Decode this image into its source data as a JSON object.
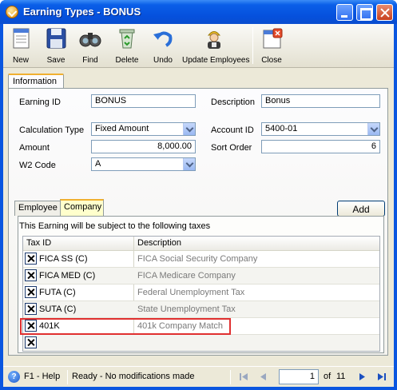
{
  "window": {
    "title": "Earning Types - BONUS"
  },
  "toolbar": {
    "new": "New",
    "save": "Save",
    "find": "Find",
    "delete": "Delete",
    "undo": "Undo",
    "update_employees": "Update Employees",
    "close": "Close"
  },
  "tabs": {
    "information": "Information"
  },
  "form": {
    "earning_id_label": "Earning ID",
    "earning_id": "BONUS",
    "description_label": "Description",
    "description": "Bonus",
    "calc_type_label": "Calculation Type",
    "calc_type": "Fixed Amount",
    "account_id_label": "Account ID",
    "account_id": "5400-01",
    "amount_label": "Amount",
    "amount": "8,000.00",
    "sort_order_label": "Sort Order",
    "sort_order": "6",
    "w2_code_label": "W2 Code",
    "w2_code": "A"
  },
  "subtabs": {
    "employee": "Employee",
    "company": "Company"
  },
  "add_button": "Add",
  "taxes": {
    "caption": "This Earning will be subject to the following taxes",
    "columns": [
      "Tax ID",
      "Description"
    ],
    "rows": [
      {
        "id": "FICA SS (C)",
        "desc": "FICA Social Security Company"
      },
      {
        "id": "FICA MED (C)",
        "desc": "FICA Medicare Company"
      },
      {
        "id": "FUTA (C)",
        "desc": "Federal Unemployment Tax"
      },
      {
        "id": "SUTA (C)",
        "desc": "State Unemployment Tax"
      },
      {
        "id": "401K",
        "desc": "401k Company Match"
      },
      {
        "id": "",
        "desc": ""
      }
    ]
  },
  "status": {
    "help": "F1 - Help",
    "message": "Ready - No modifications made",
    "page": "1",
    "of_label": "of",
    "total": "11"
  },
  "colors": {
    "title_bar": "#0550dc",
    "active_tab": "#f0b030",
    "highlight": "#e03030"
  }
}
